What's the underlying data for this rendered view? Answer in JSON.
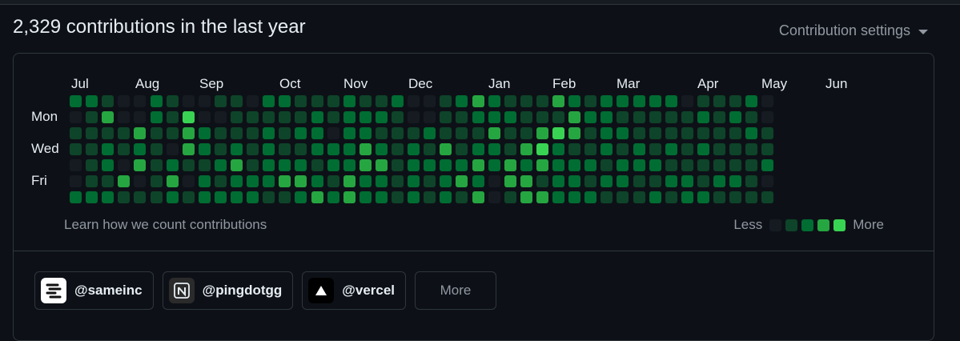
{
  "header": {
    "title": "2,329 contributions in the last year",
    "settings_label": "Contribution settings"
  },
  "calendar": {
    "months": [
      "Jul",
      "Aug",
      "Sep",
      "Oct",
      "Nov",
      "Dec",
      "Jan",
      "Feb",
      "Mar",
      "Apr",
      "May",
      "Jun"
    ],
    "days": [
      "Mon",
      "Wed",
      "Fri"
    ],
    "levels": [
      "22100210011022111211200123211132122222011120",
      "01300214001111121222100112221113221111121210",
      "11113113211121220221112111311343122111111121",
      "11212103212121122232121312213421121212121111",
      "01203121123122212233122223232322212221111112",
      "01130130212223321322121232033122122112212210",
      "22211121222211232322121213013322211121221111"
    ],
    "colors": [
      "#161b22",
      "#0e4429",
      "#006d32",
      "#26a641",
      "#39d353"
    ]
  },
  "footer": {
    "learn_link": "Learn how we count contributions",
    "legend_less": "Less",
    "legend_more": "More"
  },
  "orgs": [
    {
      "handle": "@sameinc",
      "icon": "sameinc-logo-icon"
    },
    {
      "handle": "@pingdotgg",
      "icon": "pingdotgg-logo-icon"
    },
    {
      "handle": "@vercel",
      "icon": "vercel-triangle-icon"
    }
  ],
  "more_label": "More"
}
